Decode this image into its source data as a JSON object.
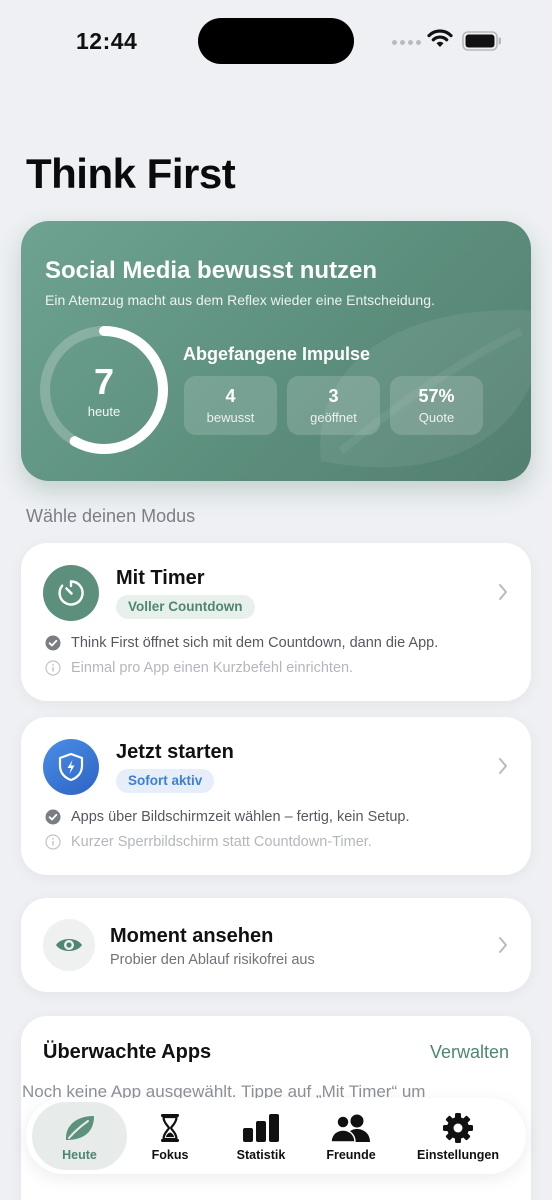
{
  "status_bar": {
    "time": "12:44"
  },
  "page_title": "Think First",
  "hero": {
    "title": "Social Media bewusst nutzen",
    "subtitle": "Ein Atemzug macht aus dem Reflex wieder eine Entscheidung.",
    "ring": {
      "count": "7",
      "label": "heute"
    },
    "impulses_title": "Abgefangene Impulse",
    "stats": [
      {
        "value": "4",
        "label": "bewusst"
      },
      {
        "value": "3",
        "label": "geöffnet"
      },
      {
        "value": "57%",
        "label": "Quote"
      }
    ]
  },
  "section_heading": "Wähle deinen Modus",
  "modes": [
    {
      "title": "Mit Timer",
      "badge": "Voller Countdown",
      "check": "Think First öffnet sich mit dem Countdown, dann die App.",
      "info": "Einmal pro App einen Kurzbefehl einrichten."
    },
    {
      "title": "Jetzt starten",
      "badge": "Sofort aktiv",
      "check": "Apps über Bildschirmzeit wählen – fertig, kein Setup.",
      "info": "Kurzer Sperrbildschirm statt Countdown-Timer."
    }
  ],
  "moment": {
    "title": "Moment ansehen",
    "subtitle": "Probier den Ablauf risikofrei aus"
  },
  "apps": {
    "title": "Überwachte Apps",
    "manage_label": "Verwalten",
    "empty_text": "Noch keine App ausgewählt. Tippe auf „Mit Timer“ um"
  },
  "tab_bar": {
    "tabs": [
      {
        "label": "Heute",
        "icon": "leaf-icon"
      },
      {
        "label": "Fokus",
        "icon": "hourglass-icon"
      },
      {
        "label": "Statistik",
        "icon": "chart-bars-icon"
      },
      {
        "label": "Freunde",
        "icon": "people-icon"
      },
      {
        "label": "Einstellungen",
        "icon": "gear-icon"
      }
    ],
    "active": "Heute"
  },
  "colors": {
    "accent_green": "#4e8672",
    "hero_green": "#5e917f",
    "blue": "#3e7fd6"
  }
}
